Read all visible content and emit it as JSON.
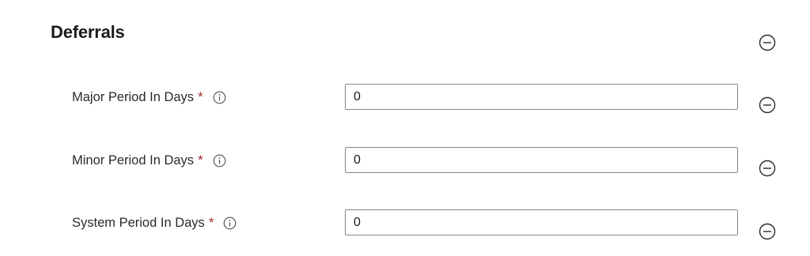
{
  "section": {
    "title": "Deferrals"
  },
  "fields": [
    {
      "label": "Major Period In Days",
      "required_mark": "*",
      "value": "0"
    },
    {
      "label": "Minor Period In Days",
      "required_mark": "*",
      "value": "0"
    },
    {
      "label": "System Period In Days",
      "required_mark": "*",
      "value": "0"
    }
  ],
  "colors": {
    "required": "#a4262c",
    "input_border": "#8a8886",
    "icon": "#4a4a4a"
  },
  "icons": {
    "remove": "minus-circle-icon",
    "info": "info-icon"
  }
}
